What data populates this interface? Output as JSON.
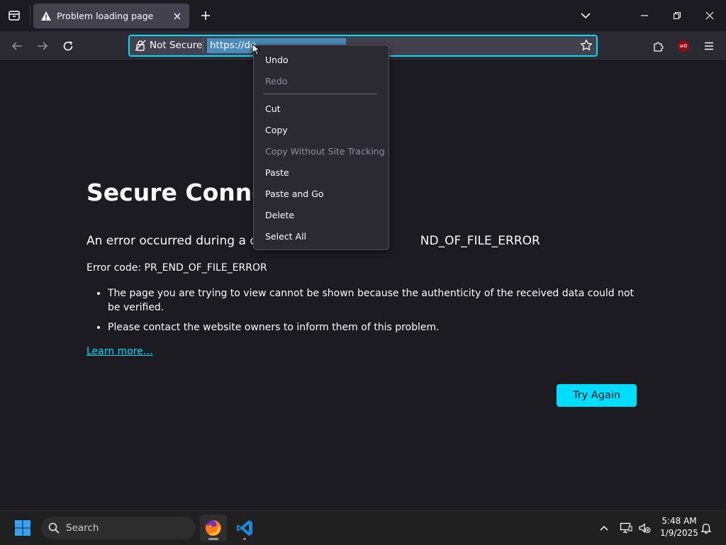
{
  "tab": {
    "title": "Problem loading page"
  },
  "urlbar": {
    "security_label": "Not Secure",
    "url_text": "https://do"
  },
  "page": {
    "title_partial": "Secure Connecti",
    "desc_left": "An error occurred during a con",
    "desc_right": "ND_OF_FILE_ERROR",
    "error_code": "Error code: PR_END_OF_FILE_ERROR",
    "bullets": [
      "The page you are trying to view cannot be shown because the authenticity of the received data could not be verified.",
      "Please contact the website owners to inform them of this problem."
    ],
    "learn_more": "Learn more…",
    "try_again": "Try Again"
  },
  "context_menu": {
    "items": [
      {
        "label": "Undo",
        "enabled": true
      },
      {
        "label": "Redo",
        "enabled": false
      },
      {
        "label": "Cut",
        "enabled": true
      },
      {
        "label": "Copy",
        "enabled": true
      },
      {
        "label": "Copy Without Site Tracking",
        "enabled": false
      },
      {
        "label": "Paste",
        "enabled": true
      },
      {
        "label": "Paste and Go",
        "enabled": true
      },
      {
        "label": "Delete",
        "enabled": true
      },
      {
        "label": "Select All",
        "enabled": true
      }
    ]
  },
  "taskbar": {
    "search_placeholder": "Search",
    "time": "5:48 AM",
    "date": "1/9/2025"
  },
  "colors": {
    "accent": "#00ddff",
    "page_bg": "#1c1b22",
    "toolbar_bg": "#2b2a33",
    "tab_bg": "#42414d"
  }
}
